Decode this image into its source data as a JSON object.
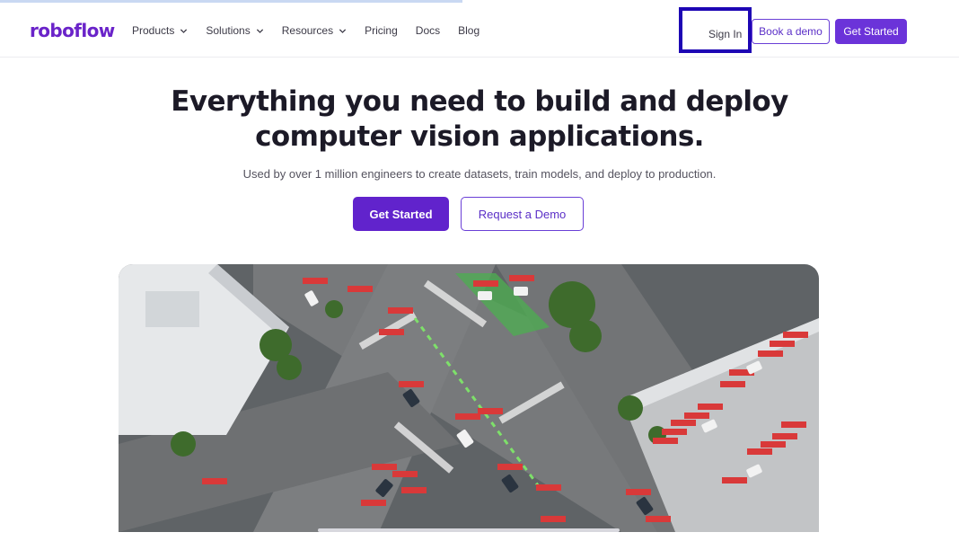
{
  "brand": {
    "logo_text": "roboflow",
    "accent": "#6b33d9"
  },
  "nav": {
    "items": [
      {
        "label": "Products",
        "has_dropdown": true
      },
      {
        "label": "Solutions",
        "has_dropdown": true
      },
      {
        "label": "Resources",
        "has_dropdown": true
      },
      {
        "label": "Pricing",
        "has_dropdown": false
      },
      {
        "label": "Docs",
        "has_dropdown": false
      },
      {
        "label": "Blog",
        "has_dropdown": false
      }
    ],
    "sign_in": "Sign In",
    "book_demo": "Book a demo",
    "get_started": "Get Started"
  },
  "hero": {
    "title_line1": "Everything you need to build and deploy",
    "title_line2": "computer vision applications.",
    "subtitle": "Used by over 1 million engineers to create datasets, train models, and deploy to production.",
    "cta_primary": "Get Started",
    "cta_secondary": "Request a Demo"
  },
  "media": {
    "description_icon": "aerial-intersection-detection-video",
    "detections": [
      "49 car",
      "33 car",
      "39 car",
      "16 car",
      "28 car",
      "41 car",
      "13 car",
      "12 car",
      "8 car",
      "17 car",
      "2 car",
      "59 car",
      "11 car",
      "23 car",
      "22 car",
      "14 car",
      "60 car",
      "3 car",
      "27 car",
      "32 car",
      "18 car",
      "47 car",
      "35 car",
      "46 car",
      "4 car",
      "6 car",
      "20 car",
      "34 car",
      "44 car",
      "37 car",
      "40 car",
      "19 car",
      "31 car",
      "45 car"
    ]
  }
}
